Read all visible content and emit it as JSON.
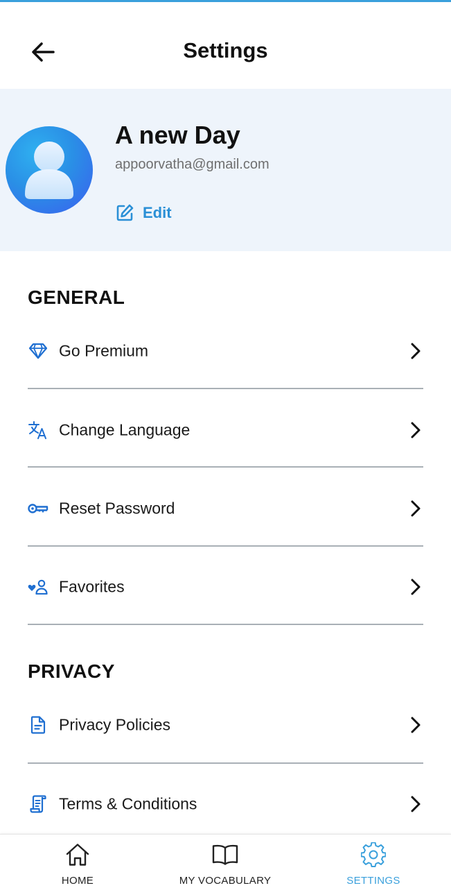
{
  "header": {
    "title": "Settings"
  },
  "profile": {
    "name": "A new Day",
    "email": "appoorvatha@gmail.com",
    "edit_label": "Edit"
  },
  "sections": {
    "general": {
      "title": "GENERAL",
      "items": [
        {
          "label": "Go Premium",
          "icon": "diamond-icon"
        },
        {
          "label": "Change Language",
          "icon": "translate-icon"
        },
        {
          "label": "Reset Password",
          "icon": "key-icon"
        },
        {
          "label": "Favorites",
          "icon": "favorite-person-icon"
        }
      ]
    },
    "privacy": {
      "title": "PRIVACY",
      "items": [
        {
          "label": "Privacy Policies",
          "icon": "document-icon"
        },
        {
          "label": "Terms & Conditions",
          "icon": "scroll-document-icon"
        }
      ]
    }
  },
  "bottom_nav": {
    "items": [
      {
        "label": "HOME",
        "icon": "home-icon",
        "active": false
      },
      {
        "label": "MY VOCABULARY",
        "icon": "book-icon",
        "active": false
      },
      {
        "label": "SETTINGS",
        "icon": "gear-icon",
        "active": true
      }
    ]
  },
  "colors": {
    "accent": "#3aa0dc",
    "icon_blue": "#1f6fd1",
    "profile_bg": "#eef4fb",
    "divider": "#a9b0b6"
  }
}
